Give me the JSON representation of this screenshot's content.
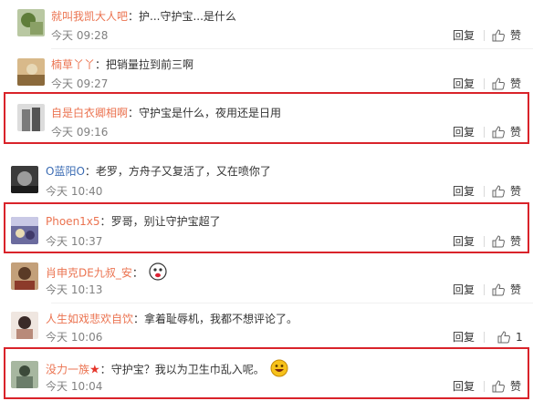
{
  "labels": {
    "reply": "回复",
    "like": "赞",
    "colon": "："
  },
  "comments": [
    {
      "user": "就叫我凯大人吧",
      "text": "护...守护宝...是什么",
      "time": "今天 09:28",
      "likes": ""
    },
    {
      "user": "楠草丫丫",
      "text": "把销量拉到前三啊",
      "time": "今天 09:27",
      "likes": ""
    },
    {
      "user": "自是白衣卿相啊",
      "text": "守护宝是什么，夜用还是日用",
      "time": "今天 09:16",
      "likes": ""
    },
    {
      "user": "O蓝阳O",
      "text": "老罗，方舟子又复活了，又在喷你了",
      "time": "今天 10:40",
      "likes": ""
    },
    {
      "user": "Phoen1x5",
      "text": "罗哥，别让守护宝超了",
      "time": "今天 10:37",
      "likes": ""
    },
    {
      "user": "肖申克DE九叔_安",
      "text": "",
      "time": "今天 10:13",
      "likes": ""
    },
    {
      "user": "人生如戏悲欢自饮",
      "text": "拿着耻辱机，我都不想评论了。",
      "time": "今天 10:06",
      "likes": "1"
    },
    {
      "user": "没力一族",
      "text": "守护宝？我以为卫生巾乱入呢。",
      "time": "今天 10:04",
      "likes": ""
    }
  ],
  "colors": {
    "username": "#eb7350",
    "username_alt": "#3a6bb3",
    "highlight": "#d9232a",
    "time": "#808080"
  },
  "icons": {
    "like": "thumbs-up-icon",
    "emoji": "emoji-face-icon",
    "badge": "star-badge-icon"
  }
}
